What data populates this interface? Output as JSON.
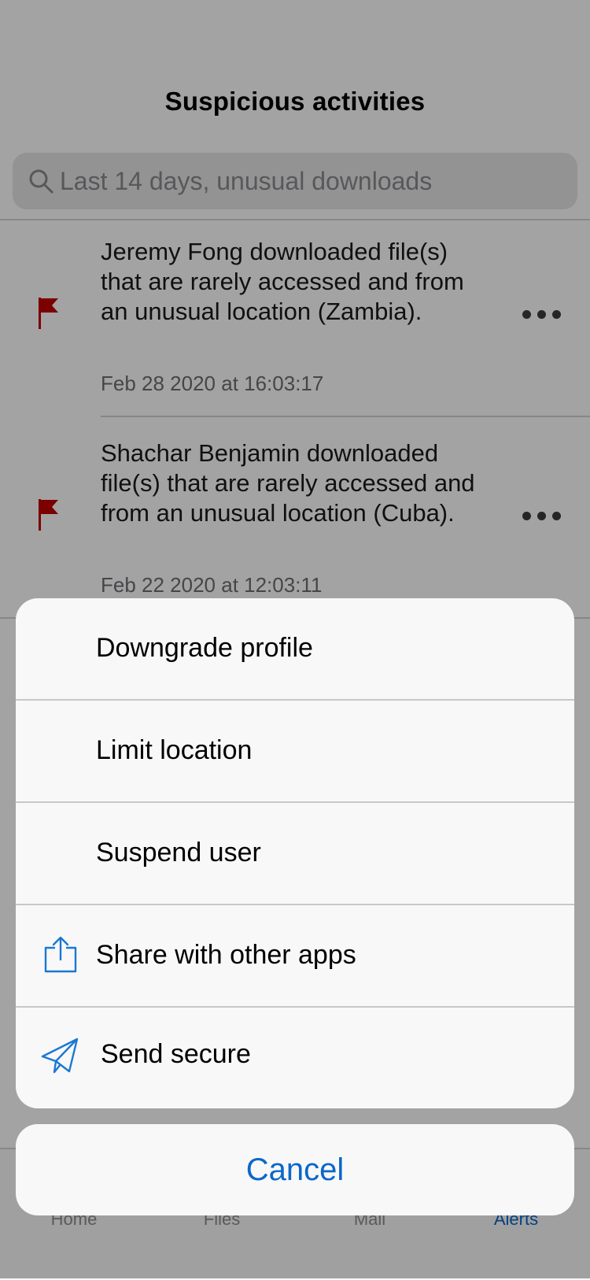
{
  "header": {
    "title": "Suspicious activities"
  },
  "search": {
    "placeholder": "Last 14 days, unusual downloads"
  },
  "alerts": [
    {
      "message": "Jeremy Fong downloaded file(s) that are rarely accessed and from an unusual location (Zambia).",
      "timestamp": "Feb 28 2020 at 16:03:17"
    },
    {
      "message": "Shachar Benjamin downloaded file(s) that are rarely accessed and from an unusual location (Cuba).",
      "timestamp": "Feb 22 2020 at 12:03:11"
    }
  ],
  "tabs": [
    {
      "label": "Home"
    },
    {
      "label": "Files"
    },
    {
      "label": "Mail"
    },
    {
      "label": "Alerts",
      "active": true
    }
  ],
  "action_sheet": {
    "items": [
      {
        "label": "Downgrade profile",
        "icon": ""
      },
      {
        "label": "Limit location",
        "icon": ""
      },
      {
        "label": "Suspend user",
        "icon": ""
      },
      {
        "label": "Share with other apps",
        "icon": "share-icon"
      },
      {
        "label": "Send secure",
        "icon": "paper-plane-icon"
      }
    ],
    "cancel_label": "Cancel"
  },
  "colors": {
    "flag": "#c00000",
    "accent": "#0a68c9",
    "icon_blue": "#1a78d2"
  }
}
